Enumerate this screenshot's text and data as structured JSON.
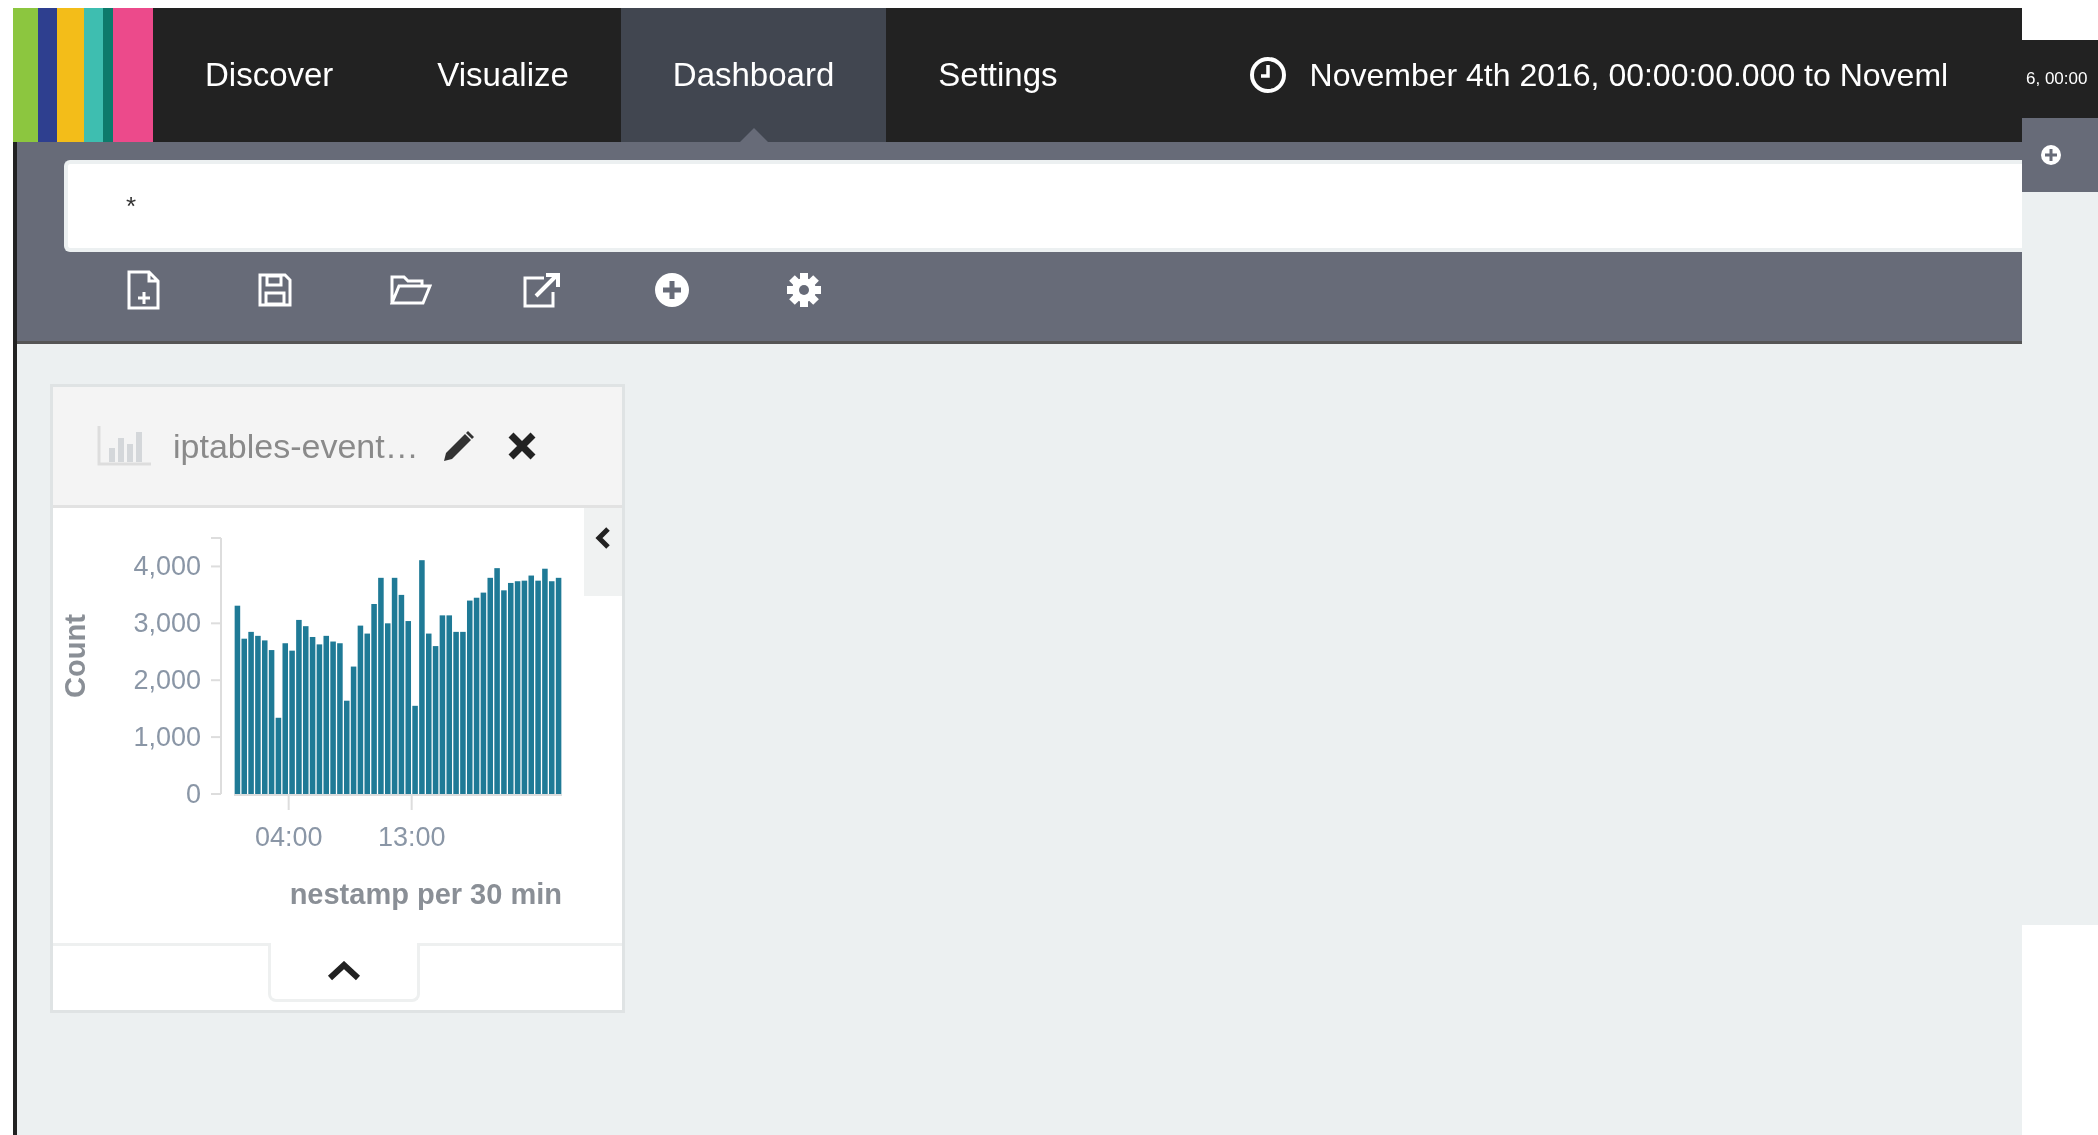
{
  "nav": {
    "tabs": [
      {
        "label": "Discover",
        "selected": false
      },
      {
        "label": "Visualize",
        "selected": false
      },
      {
        "label": "Dashboard",
        "selected": true
      },
      {
        "label": "Settings",
        "selected": false
      }
    ],
    "time_range": "November 4th 2016, 00:00:00.000 to Noveml"
  },
  "query": {
    "value": "*"
  },
  "overlay": {
    "time_fragment": "6, 00:00"
  },
  "panel": {
    "title": "iptables-event…",
    "chart_data": {
      "type": "bar",
      "ylabel": "Count",
      "xlabel": "nestamp per 30 min",
      "ylim": [
        0,
        4500
      ],
      "yticks": [
        0,
        {
          "value": 1000,
          "label": "1,000"
        },
        {
          "value": 2000,
          "label": "2,000"
        },
        {
          "value": 3000,
          "label": "3,000"
        },
        {
          "value": 4000,
          "label": "4,000"
        }
      ],
      "xticks": [
        {
          "value": 4,
          "label": "04:00"
        },
        {
          "value": 13,
          "label": "13:00"
        }
      ],
      "xlim": [
        0,
        24
      ],
      "x": [
        0.25,
        0.75,
        1.25,
        1.75,
        2.25,
        2.75,
        3.25,
        3.75,
        4.25,
        4.75,
        5.25,
        5.75,
        6.25,
        6.75,
        7.25,
        7.75,
        8.25,
        8.75,
        9.25,
        9.75,
        10.25,
        10.75,
        11.25,
        11.75,
        12.25,
        12.75,
        13.25,
        13.75,
        14.25,
        14.75,
        15.25,
        15.75,
        16.25,
        16.75,
        17.25,
        17.75,
        18.25,
        18.75,
        19.25,
        19.75,
        20.25,
        20.75,
        21.25,
        21.75,
        22.25,
        22.75,
        23.25,
        23.75
      ],
      "series": [
        {
          "color": "#1f7a96",
          "values": [
            3310,
            2730,
            2850,
            2780,
            2700,
            2530,
            1340,
            2650,
            2520,
            3060,
            2950,
            2760,
            2630,
            2780,
            2680,
            2650,
            1640,
            2240,
            2960,
            2820,
            3340,
            3800,
            3000,
            3800,
            3500,
            3040,
            1550,
            4110,
            2820,
            2600,
            3140,
            3140,
            2850,
            2850,
            3400,
            3450,
            3540,
            3800,
            3970,
            3580,
            3710,
            3740,
            3750,
            3840,
            3750,
            3960,
            3740,
            3800
          ]
        }
      ]
    }
  }
}
